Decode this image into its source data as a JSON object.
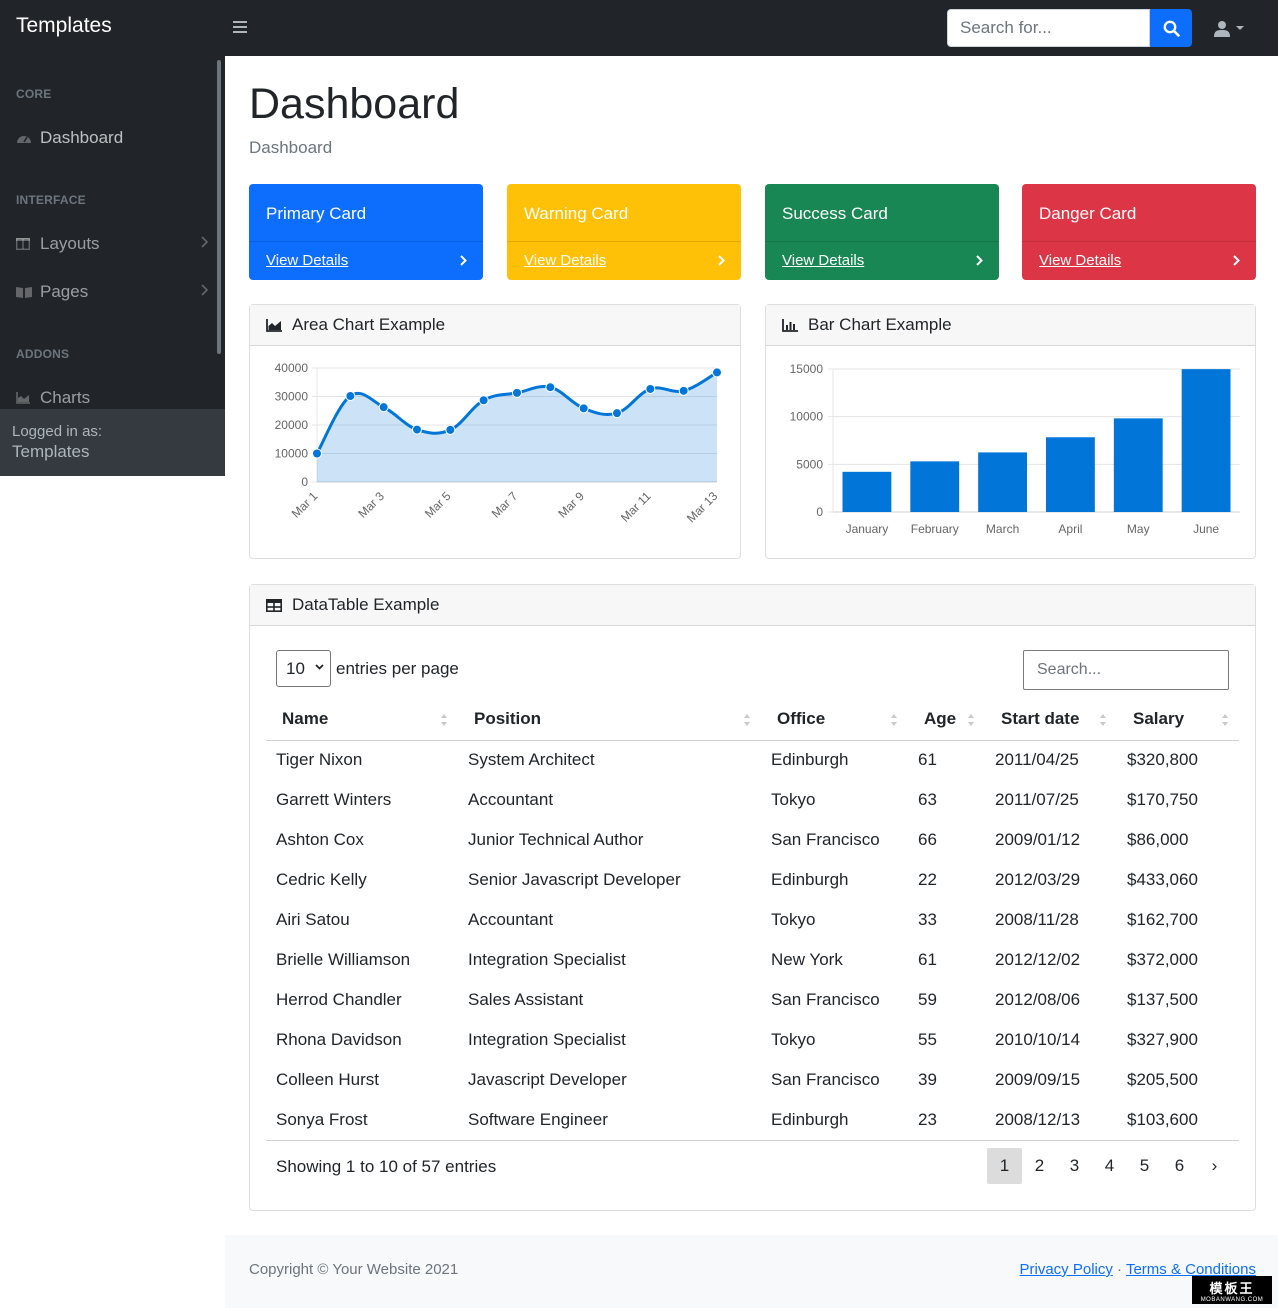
{
  "brand": "Templates",
  "search": {
    "placeholder": "Search for..."
  },
  "sidebar": {
    "sections": [
      {
        "heading": "CORE",
        "items": [
          {
            "label": "Dashboard",
            "icon": "gauge-icon"
          }
        ]
      },
      {
        "heading": "INTERFACE",
        "items": [
          {
            "label": "Layouts",
            "icon": "columns-icon"
          },
          {
            "label": "Pages",
            "icon": "book-icon"
          }
        ]
      },
      {
        "heading": "ADDONS",
        "items": [
          {
            "label": "Charts",
            "icon": "area-chart-icon"
          }
        ]
      }
    ],
    "footer": {
      "logged_in_label": "Logged in as:",
      "user": "Templates"
    }
  },
  "page": {
    "title": "Dashboard",
    "breadcrumb": "Dashboard"
  },
  "stat_cards": [
    {
      "title": "Primary Card",
      "link": "View Details",
      "color": "#0d6efd"
    },
    {
      "title": "Warning Card",
      "link": "View Details",
      "color": "#ffc107"
    },
    {
      "title": "Success Card",
      "link": "View Details",
      "color": "#198754"
    },
    {
      "title": "Danger Card",
      "link": "View Details",
      "color": "#dc3545"
    }
  ],
  "area_card": {
    "title": "Area Chart Example"
  },
  "bar_card": {
    "title": "Bar Chart Example"
  },
  "chart_data": [
    {
      "type": "area",
      "x": [
        "Mar 1",
        "Mar 2",
        "Mar 3",
        "Mar 4",
        "Mar 5",
        "Mar 6",
        "Mar 7",
        "Mar 8",
        "Mar 9",
        "Mar 10",
        "Mar 11",
        "Mar 12",
        "Mar 13"
      ],
      "tick_labels": [
        "Mar 1",
        "Mar 3",
        "Mar 5",
        "Mar 7",
        "Mar 9",
        "Mar 11",
        "Mar 13"
      ],
      "values": [
        10000,
        30162,
        26263,
        18394,
        18287,
        28682,
        31274,
        33259,
        25849,
        24159,
        32651,
        31984,
        38451
      ],
      "yticks": [
        0,
        10000,
        20000,
        30000,
        40000
      ],
      "ylim": [
        0,
        40000
      ],
      "color": "#0275d8",
      "fill": "rgba(2,117,216,0.2)",
      "grid": true
    },
    {
      "type": "bar",
      "categories": [
        "January",
        "February",
        "March",
        "April",
        "May",
        "June"
      ],
      "values": [
        4215,
        5312,
        6251,
        7841,
        9821,
        14984
      ],
      "yticks": [
        0,
        5000,
        10000,
        15000
      ],
      "ylim": [
        0,
        15000
      ],
      "color": "#0275d8",
      "grid": true
    }
  ],
  "datatable": {
    "title": "DataTable Example",
    "per_page_value": "10",
    "per_page_label": "entries per page",
    "search_placeholder": "Search...",
    "columns": [
      "Name",
      "Position",
      "Office",
      "Age",
      "Start date",
      "Salary"
    ],
    "rows": [
      [
        "Tiger Nixon",
        "System Architect",
        "Edinburgh",
        "61",
        "2011/04/25",
        "$320,800"
      ],
      [
        "Garrett Winters",
        "Accountant",
        "Tokyo",
        "63",
        "2011/07/25",
        "$170,750"
      ],
      [
        "Ashton Cox",
        "Junior Technical Author",
        "San Francisco",
        "66",
        "2009/01/12",
        "$86,000"
      ],
      [
        "Cedric Kelly",
        "Senior Javascript Developer",
        "Edinburgh",
        "22",
        "2012/03/29",
        "$433,060"
      ],
      [
        "Airi Satou",
        "Accountant",
        "Tokyo",
        "33",
        "2008/11/28",
        "$162,700"
      ],
      [
        "Brielle Williamson",
        "Integration Specialist",
        "New York",
        "61",
        "2012/12/02",
        "$372,000"
      ],
      [
        "Herrod Chandler",
        "Sales Assistant",
        "San Francisco",
        "59",
        "2012/08/06",
        "$137,500"
      ],
      [
        "Rhona Davidson",
        "Integration Specialist",
        "Tokyo",
        "55",
        "2010/10/14",
        "$327,900"
      ],
      [
        "Colleen Hurst",
        "Javascript Developer",
        "San Francisco",
        "39",
        "2009/09/15",
        "$205,500"
      ],
      [
        "Sonya Frost",
        "Software Engineer",
        "Edinburgh",
        "23",
        "2008/12/13",
        "$103,600"
      ]
    ],
    "info": "Showing 1 to 10 of 57 entries",
    "pages": [
      "1",
      "2",
      "3",
      "4",
      "5",
      "6",
      "›"
    ],
    "active_page": "1"
  },
  "footer": {
    "copyright": "Copyright © Your Website 2021",
    "privacy": "Privacy Policy",
    "separator": "·",
    "terms": "Terms & Conditions"
  },
  "watermark": {
    "line1": "模板王",
    "line2": "MOBANWANG.COM"
  }
}
